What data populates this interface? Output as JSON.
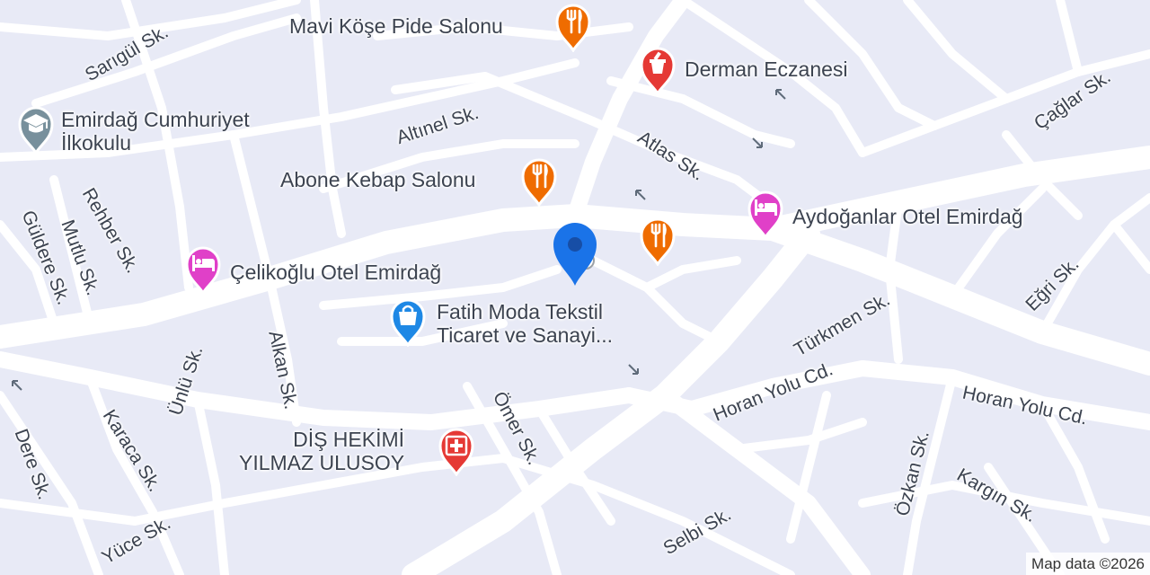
{
  "map": {
    "colors": {
      "background": "#e8eaf6",
      "road": "#ffffff",
      "restaurant": "#ef6c00",
      "pharmacy": "#e53935",
      "hotel": "#e040c8",
      "shopping": "#1e88e5",
      "school": "#78909c",
      "dentist": "#e53935",
      "location": "#1a73e8"
    },
    "streets": [
      "Sarıgül Sk.",
      "Altınel Sk.",
      "Atlas Sk.",
      "Çağlar Sk.",
      "Rehber Sk.",
      "Mutlu Sk.",
      "Güldere Sk.",
      "Ünlü Sk.",
      "Alkan Sk.",
      "Karaca Sk.",
      "Dere Sk.",
      "Yüce Sk.",
      "Ömer Sk.",
      "Selbi Sk.",
      "Türkmen Sk.",
      "Eğri Sk.",
      "Horan Yolu Cd.",
      "Horan Yolu Cd.",
      "Özkan Sk.",
      "Kargın Sk."
    ],
    "pois": [
      {
        "name": "Mavi Köşe Pide Salonu",
        "icon": "restaurant-icon"
      },
      {
        "name": "Derman Eczanesi",
        "icon": "pharmacy-icon"
      },
      {
        "name_line1": "Emirdağ Cumhuriyet",
        "name_line2": "İlkokulu",
        "icon": "school-icon"
      },
      {
        "name": "Abone Kebap Salonu",
        "icon": "restaurant-icon"
      },
      {
        "name": "Aydoğanlar Otel Emirdağ",
        "icon": "hotel-icon"
      },
      {
        "name": "Çelikoğlu Otel Emirdağ",
        "icon": "hotel-icon"
      },
      {
        "name_line1": "Fatih Moda Tekstil",
        "name_line2": "Ticaret ve Sanayi...",
        "icon": "shopping-bag-icon"
      },
      {
        "name_line1": "DİŞ HEKİMİ",
        "name_line2": "YILMAZ ULUSOY",
        "icon": "dentist-icon"
      },
      {
        "name": "",
        "icon": "restaurant-icon"
      }
    ],
    "location_marker": "location-pin-icon",
    "copyright": "Map data ©2026"
  }
}
